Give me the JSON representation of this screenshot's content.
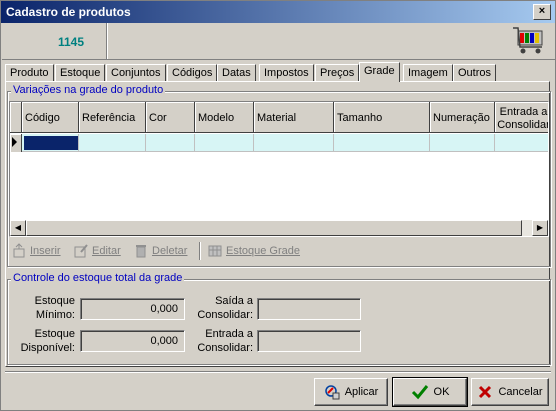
{
  "window": {
    "title": "Cadastro de produtos",
    "close_glyph": "×"
  },
  "header": {
    "product_code": "1145",
    "cart_icon": "shopping-cart-icon"
  },
  "tabs": [
    {
      "label": "Produto"
    },
    {
      "label": "Estoque"
    },
    {
      "label": "Conjuntos"
    },
    {
      "label": "Códigos"
    },
    {
      "label": "Datas"
    },
    {
      "label": "Impostos"
    },
    {
      "label": "Preços"
    },
    {
      "label": "Grade"
    },
    {
      "label": "Imagem"
    },
    {
      "label": "Outros"
    }
  ],
  "active_tab": "Grade",
  "variations": {
    "legend": "Variações na grade do produto",
    "columns": [
      "Código",
      "Referência",
      "Cor",
      "Modelo",
      "Material",
      "Tamanho",
      "Numeração",
      "Entrada a Consolidar"
    ]
  },
  "toolbar": {
    "insert": "Inserir",
    "edit": "Editar",
    "delete": "Deletar",
    "stock_grid": "Estoque Grade"
  },
  "stock_control": {
    "legend": "Controle do estoque total da grade",
    "min_stock_label": "Estoque Mínimo:",
    "min_stock_value": "0,000",
    "available_stock_label": "Estoque Disponível:",
    "available_stock_value": "0,000",
    "exit_to_consolidate_label": "Saída a Consolidar:",
    "exit_to_consolidate_value": "",
    "entry_to_consolidate_label": "Entrada a Consolidar:",
    "entry_to_consolidate_value": ""
  },
  "buttons": {
    "apply": "Aplicar",
    "ok": "OK",
    "cancel": "Cancelar"
  },
  "colors": {
    "title_start": "#0a246a",
    "title_end": "#a6caf0",
    "legend": "#0000c0",
    "code": "#008080",
    "grid_row": "#d7f5f5"
  }
}
